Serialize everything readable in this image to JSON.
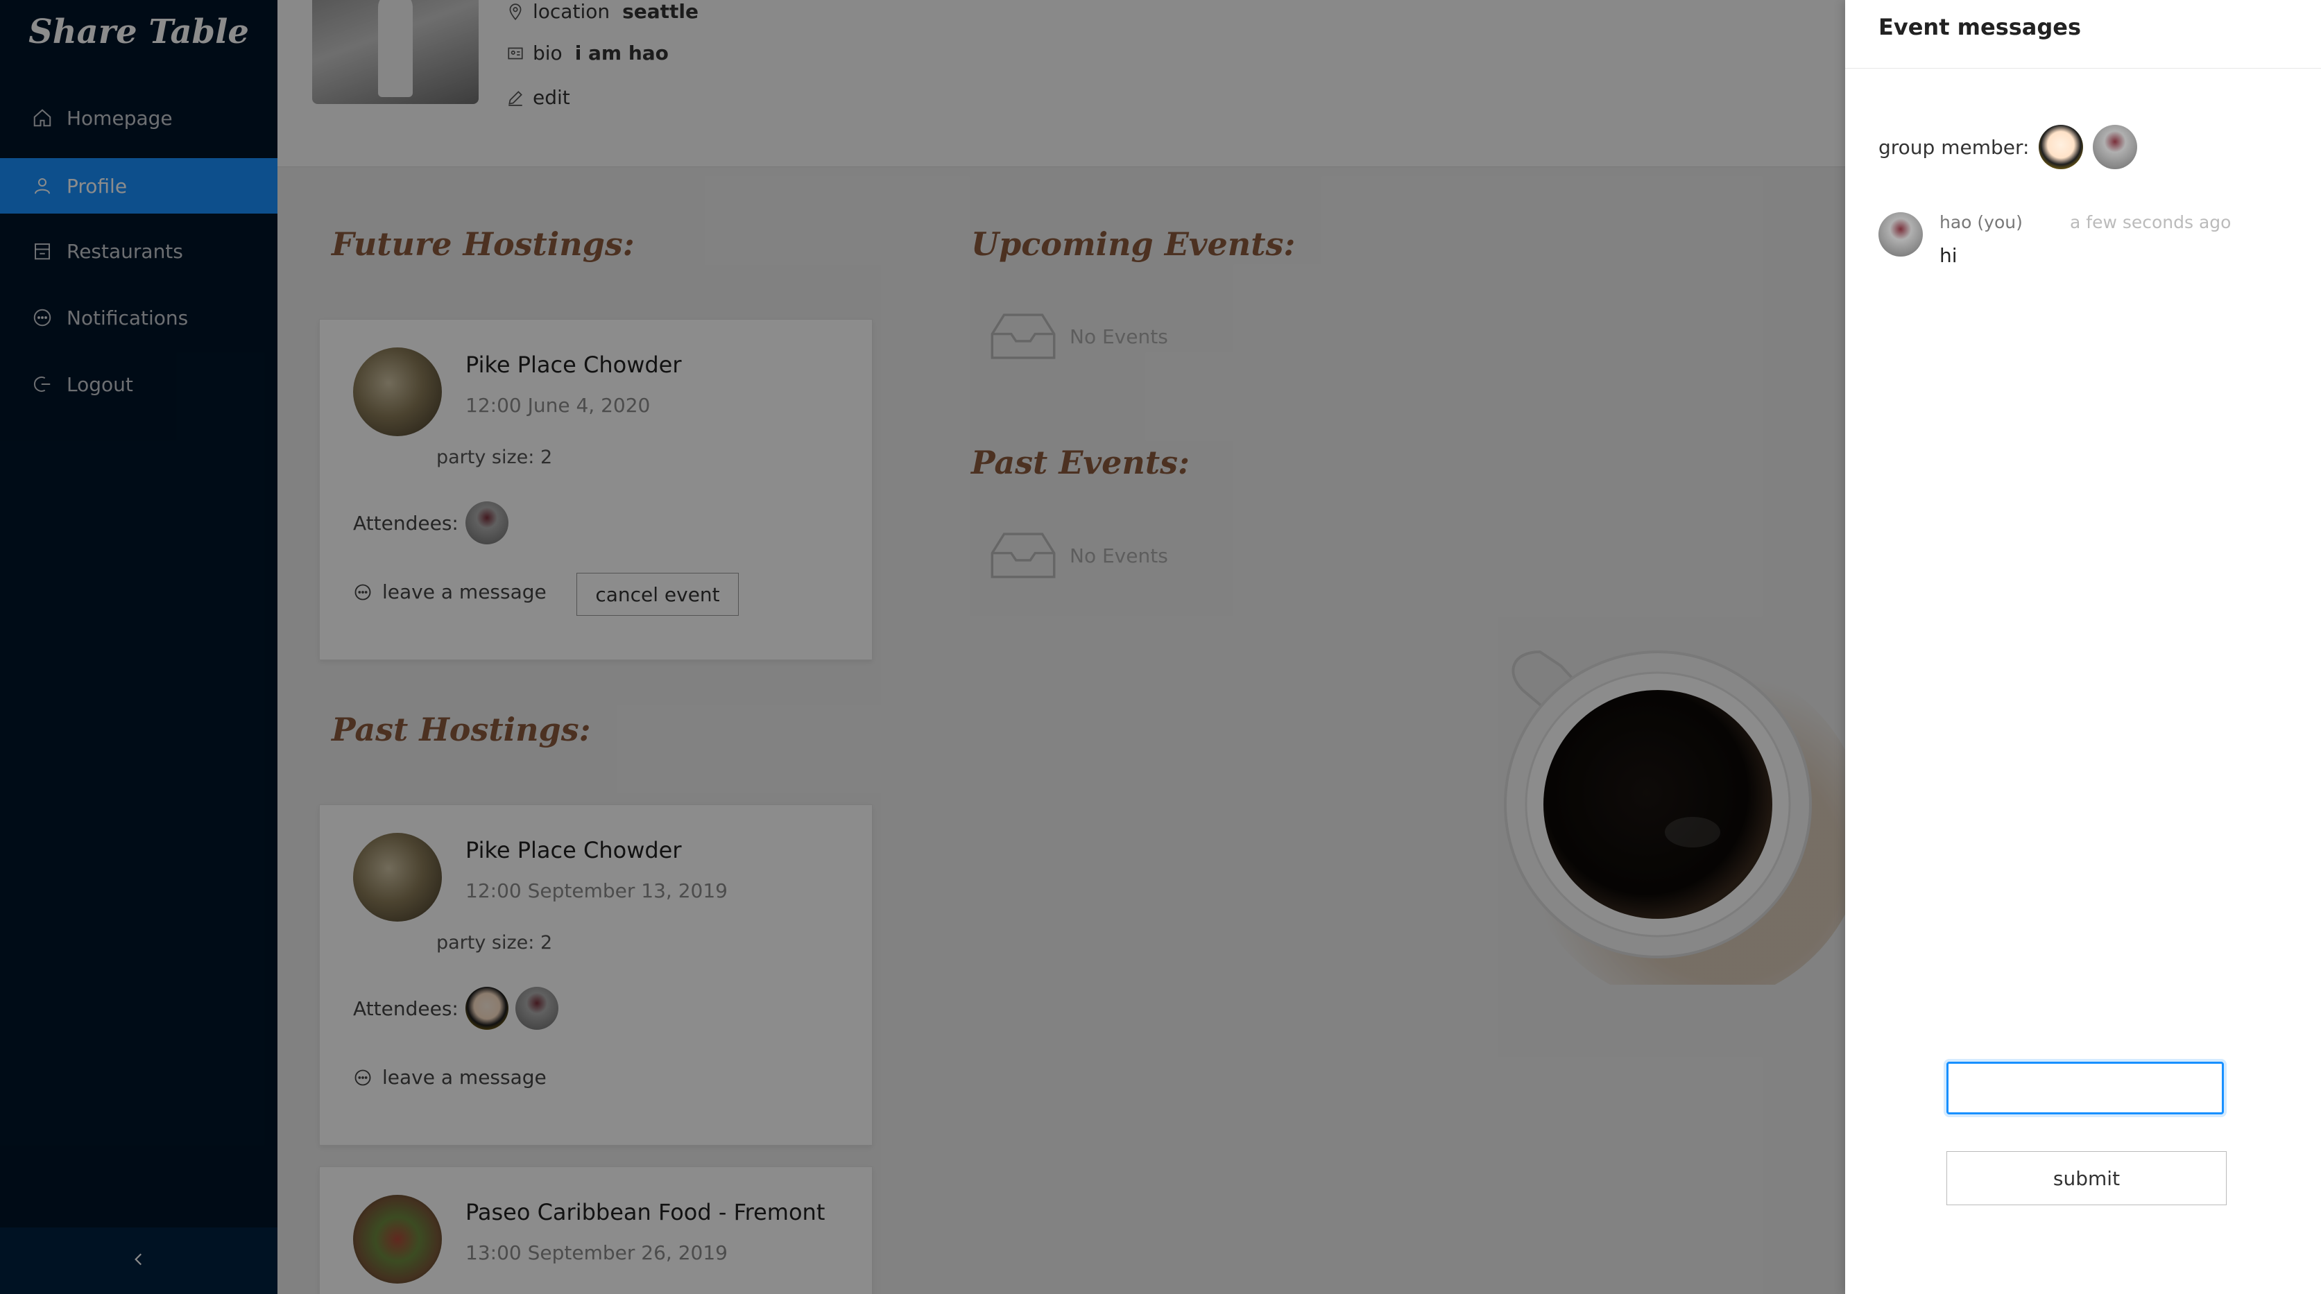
{
  "app": {
    "title": "Share Table"
  },
  "sidebar": {
    "items": [
      {
        "label": "Homepage",
        "icon": "home-icon"
      },
      {
        "label": "Profile",
        "icon": "user-icon",
        "active": true
      },
      {
        "label": "Restaurants",
        "icon": "shop-icon"
      },
      {
        "label": "Notifications",
        "icon": "message-icon"
      },
      {
        "label": "Logout",
        "icon": "logout-icon"
      }
    ],
    "collapse_icon": "chevron-left-icon"
  },
  "profile": {
    "location_label": "location",
    "location_value": "seattle",
    "bio_label": "bio",
    "bio_value": "i am hao",
    "edit_label": "edit"
  },
  "sections": {
    "future_hostings": "Future Hostings:",
    "past_hostings": "Past Hostings:",
    "upcoming_events": "Upcoming Events:",
    "past_events": "Past Events:",
    "no_events": "No Events"
  },
  "future_hostings": [
    {
      "name": "Pike Place Chowder",
      "time": "12:00 June 4, 2020",
      "party": "party size: 2",
      "attendees_label": "Attendees:",
      "leave": "leave a message",
      "cancel": "cancel event"
    }
  ],
  "past_hostings": [
    {
      "name": "Pike Place Chowder",
      "time": "12:00 September 13, 2019",
      "party": "party size: 2",
      "attendees_label": "Attendees:",
      "leave": "leave a message"
    },
    {
      "name": "Paseo Caribbean Food - Fremont",
      "time": "13:00 September 26, 2019"
    }
  ],
  "drawer": {
    "title": "Event messages",
    "group_label": "group member:",
    "messages": [
      {
        "author": "hao (you)",
        "time": "a few seconds ago",
        "text": "hi"
      }
    ],
    "input_value": "",
    "submit": "submit"
  },
  "colors": {
    "sidebar": "#001529",
    "accent": "#1890ff",
    "heading": "#8b5a3c"
  }
}
